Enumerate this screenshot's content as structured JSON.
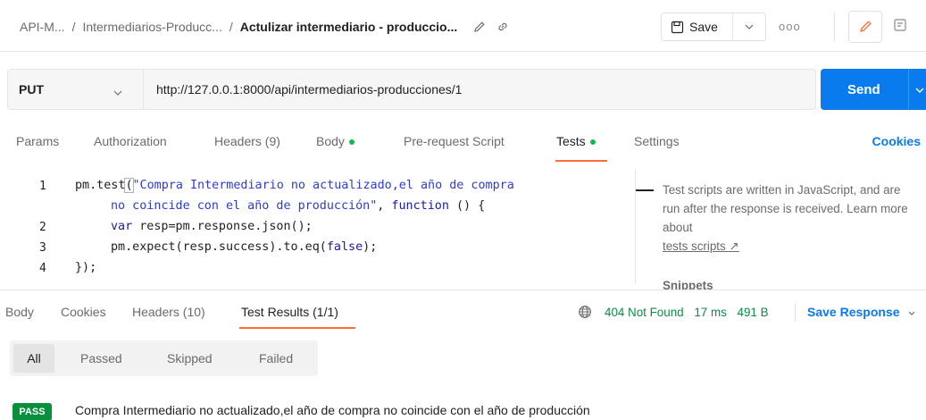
{
  "breadcrumb": {
    "parts": [
      "API-M...",
      "Intermediarios-Producc...",
      "Actulizar intermediario - produccio..."
    ],
    "separator": "/"
  },
  "toolbar": {
    "save_label": "Save",
    "more_label": "ooo"
  },
  "request": {
    "method": "PUT",
    "url": "http://127.0.0.1:8000/api/intermediarios-producciones/1",
    "send_label": "Send"
  },
  "request_tabs": {
    "params": "Params",
    "authorization": "Authorization",
    "headers": "Headers (9)",
    "body": "Body",
    "prerequest": "Pre-request Script",
    "tests": "Tests",
    "settings": "Settings",
    "cookies": "Cookies"
  },
  "editor": {
    "line_numbers": [
      "1",
      "2",
      "3",
      "4"
    ],
    "lines": {
      "l1_a": "pm.test",
      "l1_b": "(",
      "l1_c": "\"Compra Intermediario no actualizado,el año de compra",
      "l1_wrap": "no coincide con el año de producción\"",
      "l1_d": ", ",
      "l1_e": "function",
      "l1_f": " () {",
      "l2_a": "var",
      "l2_b": " resp=pm.response.json();",
      "l3_a": "pm.expect(resp.success).to.eq(",
      "l3_b": "false",
      "l3_c": ");",
      "l4": "});"
    }
  },
  "help": {
    "text": "Test scripts are written in JavaScript, and are run after the response is received. Learn more about",
    "link": "tests scripts ↗",
    "snippets": "Snippets"
  },
  "response_tabs": {
    "body": "Body",
    "cookies": "Cookies",
    "headers": "Headers (10)",
    "test_results": "Test Results (1/1)"
  },
  "response_status": {
    "code": "404 Not Found",
    "time": "17 ms",
    "size": "491 B",
    "save_response": "Save Response"
  },
  "result_filters": {
    "all": "All",
    "passed": "Passed",
    "skipped": "Skipped",
    "failed": "Failed"
  },
  "results": [
    {
      "badge": "PASS",
      "text": "Compra Intermediario no actualizado,el año de compra no coincide con el año de producción"
    }
  ],
  "colors": {
    "accent_blue": "#097bed",
    "tab_underline": "#ff6c37",
    "status_green": "#0c8d45",
    "pass_green": "#0a8f3e"
  }
}
